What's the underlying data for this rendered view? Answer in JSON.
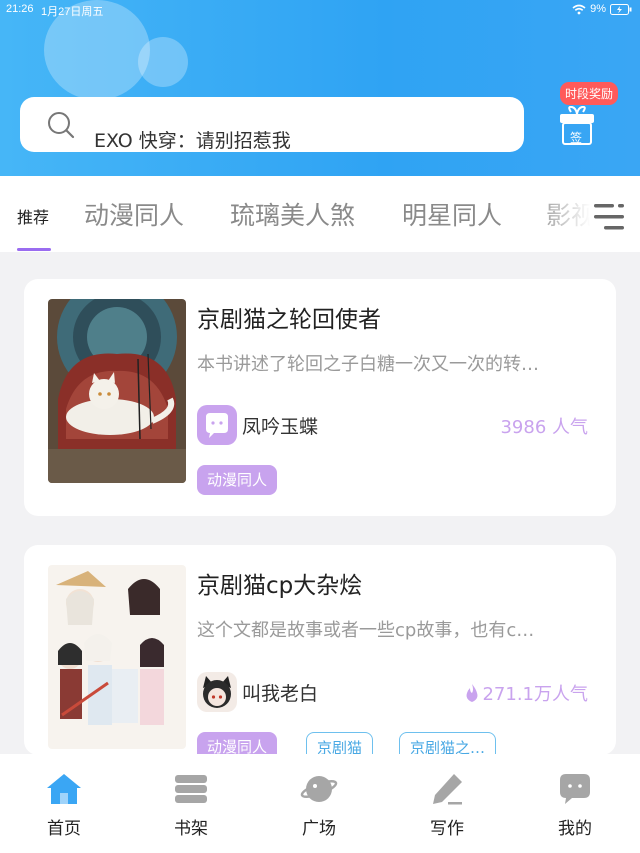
{
  "status": {
    "time": "21:26",
    "date": "1月27日周五",
    "battery": "9%"
  },
  "search": {
    "query": "EXO 快穿：请别招惹我"
  },
  "reward": {
    "badge": "时段奖励",
    "gift_label": "签"
  },
  "tabs": [
    {
      "label": "推荐"
    },
    {
      "label": "动漫同人"
    },
    {
      "label": "琉璃美人煞"
    },
    {
      "label": "明星同人"
    },
    {
      "label": "影视"
    }
  ],
  "books": [
    {
      "title": "京剧猫之轮回使者",
      "description": "本书讲述了轮回之子白糖一次又一次的转…",
      "author": "凤吟玉蝶",
      "popularity": "3986 人气",
      "tags": [
        "动漫同人"
      ]
    },
    {
      "title": "京剧猫cp大杂烩",
      "description": "这个文都是故事或者一些cp故事，也有c…",
      "author": "叫我老白",
      "popularity": "271.1万人气",
      "tags": [
        "动漫同人",
        "京剧猫",
        "京剧猫之…"
      ]
    }
  ],
  "bottom_nav": [
    {
      "label": "首页",
      "icon": "home-icon"
    },
    {
      "label": "书架",
      "icon": "bookshelf-icon"
    },
    {
      "label": "广场",
      "icon": "planet-icon"
    },
    {
      "label": "写作",
      "icon": "pen-icon"
    },
    {
      "label": "我的",
      "icon": "chat-bubble-icon"
    }
  ],
  "colors": {
    "header": "#2fa3f3",
    "accent": "#9a6cf0",
    "tag_fill": "#c8a3ee",
    "tag_outline": "#6ec0ee",
    "popularity": "#c9a3ee",
    "reward_badge": "#ff5a5a"
  }
}
